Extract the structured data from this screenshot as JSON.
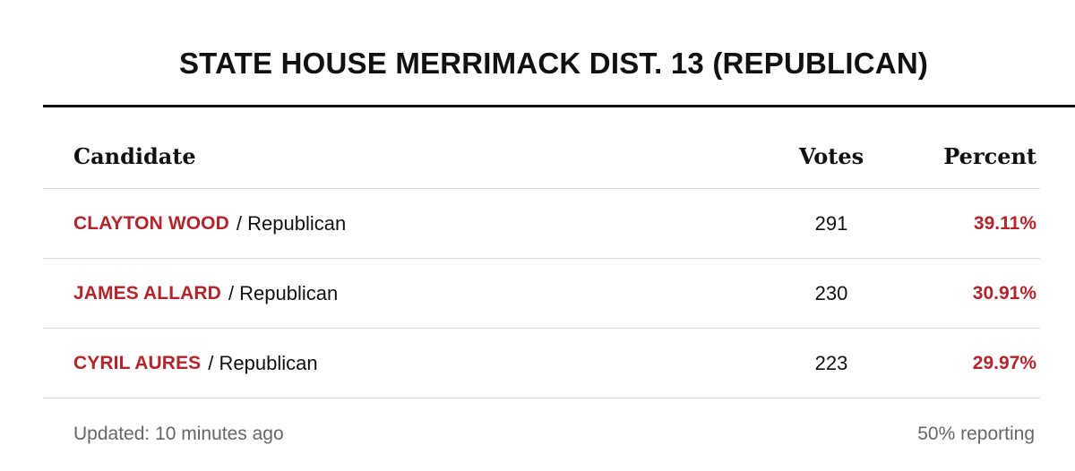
{
  "race": {
    "title": "STATE HOUSE MERRIMACK DIST. 13 (REPUBLICAN)"
  },
  "table": {
    "headers": {
      "candidate": "Candidate",
      "votes": "Votes",
      "percent": "Percent"
    },
    "rows": [
      {
        "name": "CLAYTON WOOD",
        "party": "/ Republican",
        "votes": "291",
        "percent": "39.11%"
      },
      {
        "name": "JAMES ALLARD",
        "party": "/ Republican",
        "votes": "230",
        "percent": "30.91%"
      },
      {
        "name": "CYRIL AURES",
        "party": "/ Republican",
        "votes": "223",
        "percent": "29.97%"
      }
    ]
  },
  "footer": {
    "updated": "Updated: 10 minutes ago",
    "reporting": "50% reporting"
  },
  "colors": {
    "accent": "#b3242c",
    "text": "#111111",
    "muted": "#666666",
    "divider": "#d9d9d9"
  }
}
